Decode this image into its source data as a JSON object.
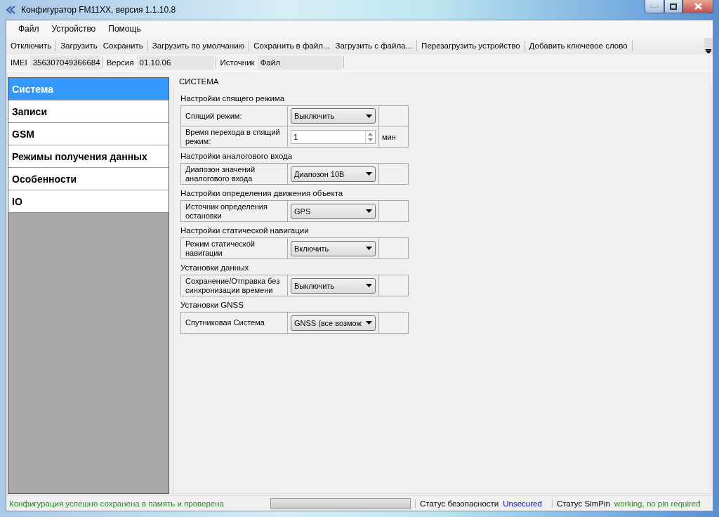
{
  "window": {
    "title": "Конфигуратор FM11XX, версия 1.1.10.8"
  },
  "menu": [
    "Файл",
    "Устройство",
    "Помощь"
  ],
  "toolbar": [
    [
      "Отключить"
    ],
    [
      "Загрузить",
      "Сохранить"
    ],
    [
      "Загрузить по умолчанию"
    ],
    [
      "Сохранить в файл...",
      "Загрузить с файла..."
    ],
    [
      "Перезагрузить устройство"
    ],
    [
      "Добавить ключевое слово"
    ]
  ],
  "info_bar": [
    {
      "label": "IMEI",
      "value": "356307049366684"
    },
    {
      "label": "Версия",
      "value": "01.10.06"
    },
    {
      "label": "Источник",
      "value": "Файл"
    }
  ],
  "sidebar": {
    "items": [
      {
        "label": "Система",
        "selected": true
      },
      {
        "label": "Записи",
        "selected": false
      },
      {
        "label": "GSM",
        "selected": false
      },
      {
        "label": "Режимы получения данных",
        "selected": false
      },
      {
        "label": "Особенности",
        "selected": false
      },
      {
        "label": "IO",
        "selected": false
      }
    ]
  },
  "panel": {
    "title": "СИСТЕМА",
    "sections": [
      {
        "title": "Настройки спящего режима",
        "rows": [
          {
            "kind": "select",
            "label": "Спящий режим:",
            "value": "Выключить"
          },
          {
            "kind": "spin",
            "label": "Время перехода в спящий режим:",
            "value": "1",
            "unit": "мин"
          }
        ]
      },
      {
        "title": "Настройки аналогового входа",
        "rows": [
          {
            "kind": "select",
            "label": "Диапозон значений аналогового входа",
            "value": "Диапозон 10В"
          }
        ]
      },
      {
        "title": "Настройки определения движения объекта",
        "rows": [
          {
            "kind": "select",
            "label": "Источник определения остановки",
            "value": "GPS"
          }
        ]
      },
      {
        "title": "Настройки статической навигации",
        "rows": [
          {
            "kind": "select",
            "label": "Режим статической навигации",
            "value": "Включить"
          }
        ]
      },
      {
        "title": "Установки данных",
        "rows": [
          {
            "kind": "select",
            "label": "Сохранение/Отправка без синхронизации времени",
            "value": "Выключить"
          }
        ]
      },
      {
        "title": "Установки GNSS",
        "rows": [
          {
            "kind": "select",
            "label": "Спутниковая Система",
            "value": "GNSS (все возмож"
          }
        ]
      }
    ]
  },
  "status_bar": {
    "message": "Конфигурация успешно сохранена в память и проверена",
    "progress": {
      "level": 0
    },
    "items": [
      {
        "label": "Статус безопасности",
        "value": "Unsecured",
        "kind": "warning"
      },
      {
        "label": "Статус SimPin",
        "value": "working, no pin required",
        "kind": "ok"
      }
    ]
  }
}
